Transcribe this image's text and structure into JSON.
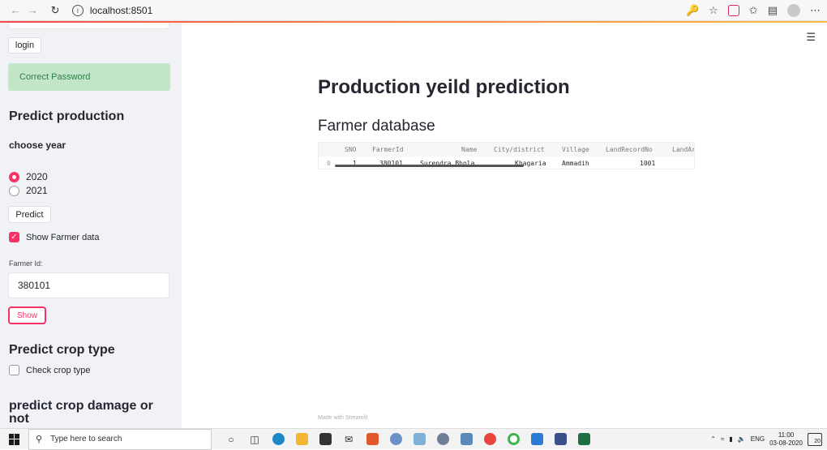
{
  "browser": {
    "url": "localhost:8501",
    "info_icon": "info-icon"
  },
  "sidebar": {
    "login_label": "login",
    "success_message": "Correct Password",
    "predict_production_heading": "Predict production",
    "choose_year_label": "choose year",
    "year_options": [
      "2020",
      "2021"
    ],
    "selected_year": "2020",
    "predict_button": "Predict",
    "show_farmer_label": "Show Farmer data",
    "show_farmer_checked": true,
    "farmer_id_label": "Farmer Id:",
    "farmer_id_value": "380101",
    "show_button": "Show",
    "predict_crop_type_heading": "Predict crop type",
    "check_crop_type_label": "Check crop type",
    "check_crop_type_checked": false,
    "predict_damage_heading": "predict crop damage or not"
  },
  "main": {
    "title": "Production yeild prediction",
    "subheader": "Farmer database",
    "table": {
      "columns": [
        "SNO",
        "FarmerId",
        "Name",
        "City/district",
        "Village",
        "LandRecordNo",
        "LandAr"
      ],
      "rows": [
        {
          "index": "0",
          "cells": [
            "1",
            "380101",
            "Surendra Bhola",
            "Khagaria",
            "Ammadih",
            "1001",
            ""
          ]
        }
      ]
    },
    "footer": "Made with Streamlit"
  },
  "taskbar": {
    "search_placeholder": "Type here to search",
    "language": "ENG",
    "time": "11:00",
    "date": "03-08-2020",
    "notification_count": "20"
  },
  "colors": {
    "accent": "#f63366",
    "success_bg": "#c3e6cb",
    "success_text": "#2f7d45",
    "sidebar_bg": "#f0f2f6"
  }
}
